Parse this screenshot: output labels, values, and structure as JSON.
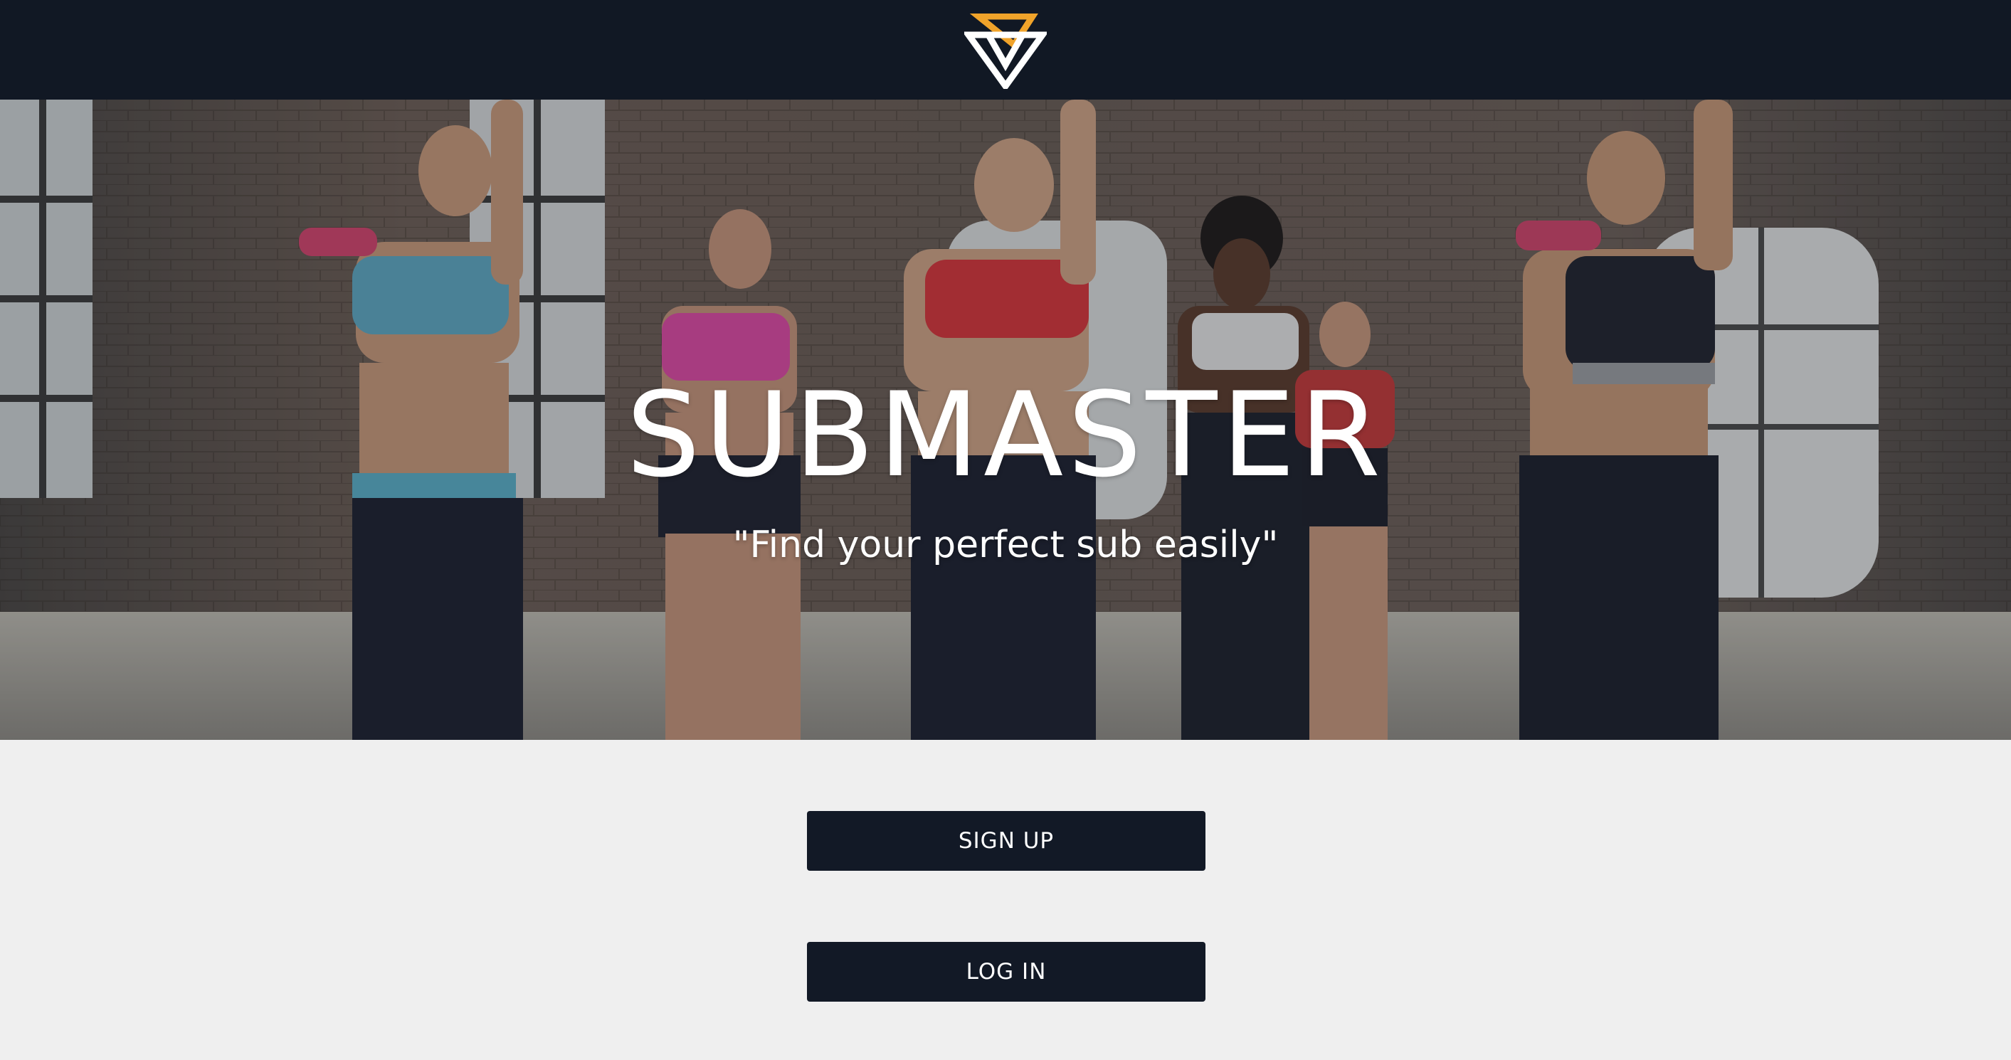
{
  "header": {
    "logo_icon": "brand-triangle-logo-icon",
    "colors": {
      "background": "#111824",
      "logo_accent": "#f0a32a",
      "logo_main": "#ffffff"
    }
  },
  "hero": {
    "title": "SUBMASTER",
    "tagline": "\"Find your perfect sub easily\""
  },
  "actions": {
    "signup_label": "SIGN UP",
    "login_label": "LOG IN",
    "button_color": "#121926"
  }
}
